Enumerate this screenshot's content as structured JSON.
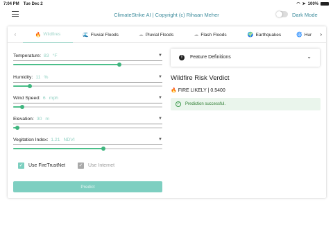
{
  "status": {
    "time": "7:04 PM",
    "date": "Tue Dec 2",
    "battery": "100%"
  },
  "header": {
    "title": "ClimateStrike AI | Copyright (c) Rihaan Meher",
    "dark_mode_label": "Dark Mode"
  },
  "tabs": [
    {
      "label": "Wildfires",
      "icon": "🔥"
    },
    {
      "label": "Fluvial Floods",
      "icon": "🌊"
    },
    {
      "label": "Pluvial Floods",
      "icon": "☁"
    },
    {
      "label": "Flash Floods",
      "icon": "☁"
    },
    {
      "label": "Earthquakes",
      "icon": "🌍"
    },
    {
      "label": "Hur",
      "icon": "🌀"
    }
  ],
  "fields": [
    {
      "label": "Temperature:",
      "value": "83",
      "unit": "°F",
      "level": 0.71
    },
    {
      "label": "Humidity:",
      "value": "11",
      "unit": "%",
      "level": 0.11
    },
    {
      "label": "Wind Speed:",
      "value": "6",
      "unit": "mph",
      "level": 0.06
    },
    {
      "label": "Elevation:",
      "value": "30",
      "unit": "m",
      "level": 0.03
    },
    {
      "label": "Vegitation Index:",
      "value": "1.21",
      "unit": "NDVI",
      "level": 0.605
    }
  ],
  "checks": [
    {
      "label": "Use FireTrustNet",
      "checked": true,
      "enabled": true
    },
    {
      "label": "Use Internet",
      "checked": true,
      "enabled": false
    }
  ],
  "predict_label": "Predict",
  "feature_panel": {
    "title": "Feature Definitions"
  },
  "verdict": {
    "title": "Wildfire Risk Verdict",
    "result": "FIRE LIKELY | 0.5400",
    "success": "Prediction successful."
  },
  "colors": {
    "accent": "#4cbf8a",
    "teal": "#8fd0c2",
    "header_text": "#3a8a9a"
  }
}
